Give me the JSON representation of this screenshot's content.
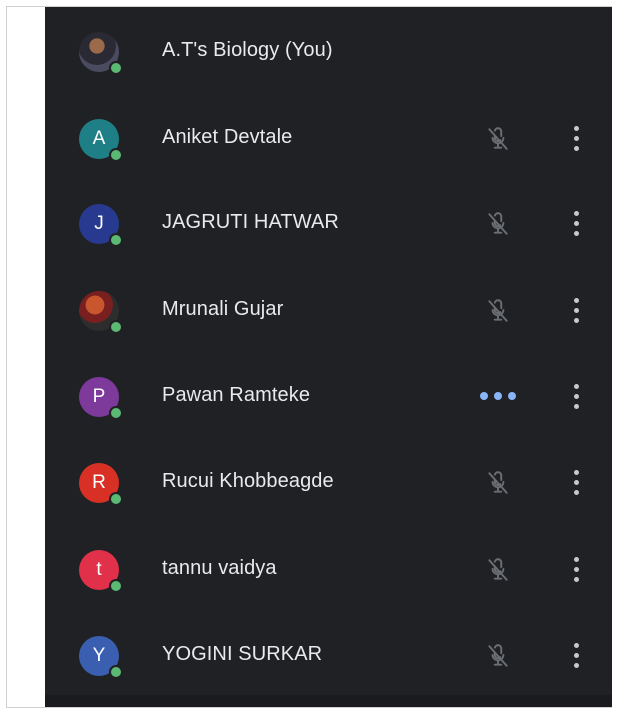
{
  "participants": [
    {
      "name": "A.T's Biology (You)",
      "avatar_letter": "",
      "avatar_color": "#3b3f52",
      "avatar_type": "photo",
      "status": "self",
      "status_icon": "none",
      "menu_icon": "none"
    },
    {
      "name": "Aniket Devtale",
      "avatar_letter": "A",
      "avatar_color": "#1e7f86",
      "status": "muted",
      "status_icon": "mic-off-icon",
      "menu_icon": "more-vert-icon"
    },
    {
      "name": "JAGRUTI HATWAR",
      "avatar_letter": "J",
      "avatar_color": "#283a8f",
      "status": "muted",
      "status_icon": "mic-off-icon",
      "menu_icon": "more-vert-icon"
    },
    {
      "name": "Mrunali Gujar",
      "avatar_letter": "",
      "avatar_color": "#7a1f1f",
      "avatar_type": "photo",
      "status": "muted",
      "status_icon": "mic-off-icon",
      "menu_icon": "more-vert-icon"
    },
    {
      "name": "Pawan Ramteke",
      "avatar_letter": "P",
      "avatar_color": "#7d3a9a",
      "status": "speaking",
      "status_icon": "speaking-dots-icon",
      "menu_icon": "more-vert-icon"
    },
    {
      "name": "Rucui Khobbeagde",
      "avatar_letter": "R",
      "avatar_color": "#d93025",
      "status": "muted",
      "status_icon": "mic-off-icon",
      "menu_icon": "more-vert-icon"
    },
    {
      "name": "tannu vaidya",
      "avatar_letter": "t",
      "avatar_color": "#e0304a",
      "status": "muted",
      "status_icon": "mic-off-icon",
      "menu_icon": "more-vert-icon"
    },
    {
      "name": "YOGINI SURKAR",
      "avatar_letter": "Y",
      "avatar_color": "#3a5fb0",
      "status": "muted",
      "status_icon": "mic-off-icon",
      "menu_icon": "more-vert-icon"
    }
  ],
  "colors": {
    "panel_background": "#202124",
    "name_text": "#e8eaed",
    "presence": "#5bb974",
    "speaking": "#8ab4f8",
    "icon": "#c7c9cc"
  }
}
